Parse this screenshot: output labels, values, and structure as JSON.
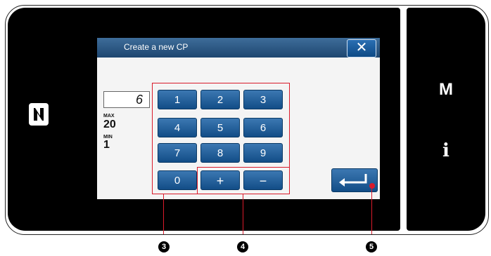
{
  "side": {
    "m_label": "M",
    "info_label": "i"
  },
  "dialog": {
    "title": "Create a new CP",
    "close_label": "✕",
    "value": "6",
    "max_label": "MAX",
    "max_value": "20",
    "min_label": "MIN",
    "min_value": "1"
  },
  "keypad": {
    "keys": [
      "1",
      "2",
      "3",
      "4",
      "5",
      "6",
      "7",
      "8",
      "9",
      "0",
      "+",
      "−"
    ]
  },
  "enter_icon": "enter-arrow-icon",
  "callouts": [
    "3",
    "4",
    "5"
  ],
  "colors": {
    "callout_red": "#d91a2a",
    "button_blue": "#1f5f9e",
    "title_blue": "#2e5a86"
  }
}
